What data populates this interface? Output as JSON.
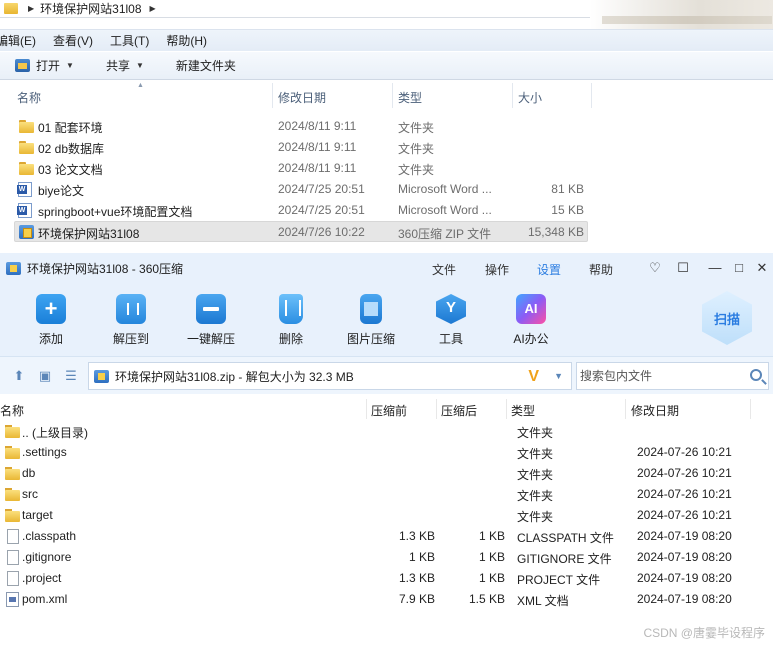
{
  "explorer": {
    "address_path": "环境保护网站31l08",
    "menu": [
      "编辑(E)",
      "查看(V)",
      "工具(T)",
      "帮助(H)"
    ],
    "toolbar": {
      "open": "打开",
      "share": "共享",
      "new_folder": "新建文件夹"
    },
    "columns": {
      "name": "名称",
      "date": "修改日期",
      "type": "类型",
      "size": "大小"
    },
    "rows": [
      {
        "name": "01 配套环境",
        "date": "2024/8/11 9:11",
        "type": "文件夹",
        "size": "",
        "icon": "folder-icon"
      },
      {
        "name": "02 db数据库",
        "date": "2024/8/11 9:11",
        "type": "文件夹",
        "size": "",
        "icon": "folder-icon"
      },
      {
        "name": "03 论文文档",
        "date": "2024/8/11 9:11",
        "type": "文件夹",
        "size": "",
        "icon": "folder-icon"
      },
      {
        "name": "biye论文",
        "date": "2024/7/25 20:51",
        "type": "Microsoft Word ...",
        "size": "81 KB",
        "icon": "word-doc-icon"
      },
      {
        "name": "springboot+vue环境配置文档",
        "date": "2024/7/25 20:51",
        "type": "Microsoft Word ...",
        "size": "15 KB",
        "icon": "word-doc-icon"
      },
      {
        "name": "环境保护网站31l08",
        "date": "2024/7/26 10:22",
        "type": "360压缩 ZIP 文件",
        "size": "15,348 KB",
        "icon": "zip-archive-icon",
        "selected": true
      }
    ]
  },
  "zip": {
    "title": "环境保护网站31l08 - 360压缩",
    "top_menu": [
      "文件",
      "操作",
      "设置",
      "帮助"
    ],
    "active_menu": "设置",
    "ribbon": [
      "添加",
      "解压到",
      "一键解压",
      "删除",
      "图片压缩",
      "工具",
      "AI办公"
    ],
    "scan_label": "扫描",
    "path_text": "环境保护网站31l08.zip - 解包大小为 32.3 MB",
    "search_placeholder": "搜索包内文件",
    "columns": {
      "name": "名称",
      "before": "压缩前",
      "after": "压缩后",
      "type": "类型",
      "date": "修改日期"
    },
    "rows": [
      {
        "name": ".. (上级目录)",
        "before": "",
        "after": "",
        "type": "文件夹",
        "date": "",
        "icon": "folder-icon"
      },
      {
        "name": ".settings",
        "before": "",
        "after": "",
        "type": "文件夹",
        "date": "2024-07-26 10:21",
        "icon": "folder-icon"
      },
      {
        "name": "db",
        "before": "",
        "after": "",
        "type": "文件夹",
        "date": "2024-07-26 10:21",
        "icon": "folder-icon"
      },
      {
        "name": "src",
        "before": "",
        "after": "",
        "type": "文件夹",
        "date": "2024-07-26 10:21",
        "icon": "folder-icon"
      },
      {
        "name": "target",
        "before": "",
        "after": "",
        "type": "文件夹",
        "date": "2024-07-26 10:21",
        "icon": "folder-icon"
      },
      {
        "name": ".classpath",
        "before": "1.3 KB",
        "after": "1 KB",
        "type": "CLASSPATH 文件",
        "date": "2024-07-19 08:20",
        "icon": "file-icon"
      },
      {
        "name": ".gitignore",
        "before": "1 KB",
        "after": "1 KB",
        "type": "GITIGNORE 文件",
        "date": "2024-07-19 08:20",
        "icon": "file-icon"
      },
      {
        "name": ".project",
        "before": "1.3 KB",
        "after": "1 KB",
        "type": "PROJECT 文件",
        "date": "2024-07-19 08:20",
        "icon": "file-icon"
      },
      {
        "name": "pom.xml",
        "before": "7.9 KB",
        "after": "1.5 KB",
        "type": "XML 文档",
        "date": "2024-07-19 08:20",
        "icon": "xml-file-icon"
      }
    ]
  },
  "watermark": "CSDN @唐霎毕设程序"
}
